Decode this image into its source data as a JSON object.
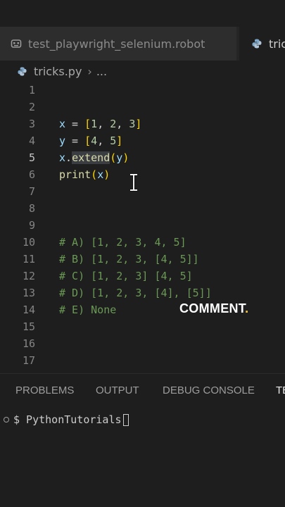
{
  "tabs": [
    {
      "label": "test_playwright_selenium.robot",
      "icon": "robot-file-icon",
      "active": false
    },
    {
      "label": "tric",
      "icon": "python-file-icon",
      "active": true
    }
  ],
  "breadcrumb": {
    "file": "tricks.py",
    "more": "..."
  },
  "code": {
    "line_numbers": [
      "1",
      "2",
      "3",
      "4",
      "5",
      "6",
      "7",
      "8",
      "9",
      "10",
      "11",
      "12",
      "13",
      "14",
      "15",
      "16",
      "17"
    ],
    "x_var": "x",
    "y_var": "y",
    "eq": " = ",
    "list_x": [
      "[",
      "1",
      ", ",
      "2",
      ", ",
      "3",
      "]"
    ],
    "list_y": [
      "[",
      "4",
      ", ",
      "5",
      "]"
    ],
    "dot": ".",
    "extend": "extend",
    "lparen": "(",
    "rparen": ")",
    "print": "print",
    "comments": [
      "# A) [1, 2, 3, 4, 5]",
      "# B) [1, 2, 3, [4, 5]]",
      "# C) [1, 2, 3] [4, 5]",
      "# D) [1, 2, 3, [4], [5]]",
      "# E) None"
    ]
  },
  "overlay": {
    "text": "COMMENT",
    "dot": "."
  },
  "panel": {
    "tabs": [
      "PROBLEMS",
      "OUTPUT",
      "DEBUG CONSOLE",
      "TE"
    ]
  },
  "terminal": {
    "prompt": "$ PythonTutorials"
  },
  "colors": {
    "background": "#1e1e1e",
    "comment": "#6a9955",
    "variable": "#9cdcfe",
    "number": "#b5cea8",
    "function": "#dcdcaa",
    "bracket": "#ffd700"
  }
}
